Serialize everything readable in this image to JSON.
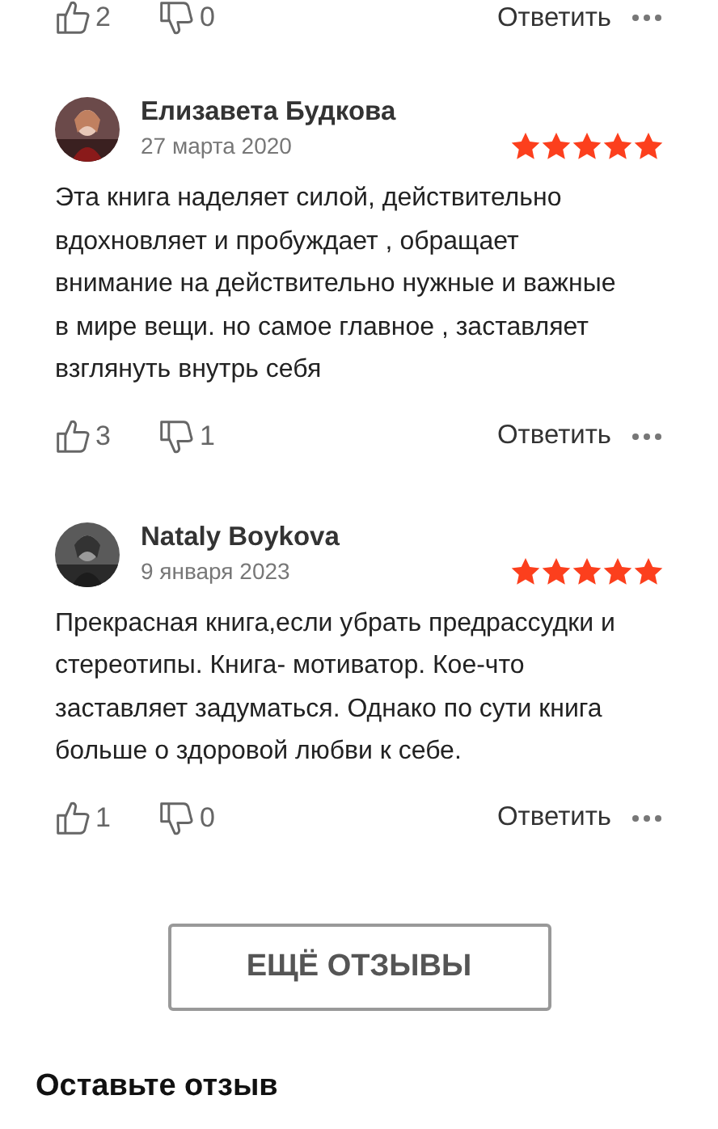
{
  "previous_review_actions": {
    "likes": "2",
    "dislikes": "0",
    "reply": "Ответить"
  },
  "reviews": [
    {
      "author": "Елизавета Будкова",
      "date": "27 марта 2020",
      "stars": 5,
      "text": "Эта книга наделяет силой, действительно вдохновляет и пробуждает , обращает внимание на действительно нужные и важные в мире вещи. но самое главное , заставляет взглянуть внутрь себя",
      "likes": "3",
      "dislikes": "1",
      "reply": "Ответить"
    },
    {
      "author": "Nataly Boykova",
      "date": "9 января 2023",
      "stars": 5,
      "text": "Прекрасная книга,если убрать предрассудки и стереотипы. Книга- мотиватор. Кое-что заставляет задуматься. Однако по сути книга больше о здоровой любви к себе.",
      "likes": "1",
      "dislikes": "0",
      "reply": "Ответить"
    }
  ],
  "more_button": "ЕЩЁ ОТЗЫВЫ",
  "leave_review_heading": "Оставьте отзыв"
}
